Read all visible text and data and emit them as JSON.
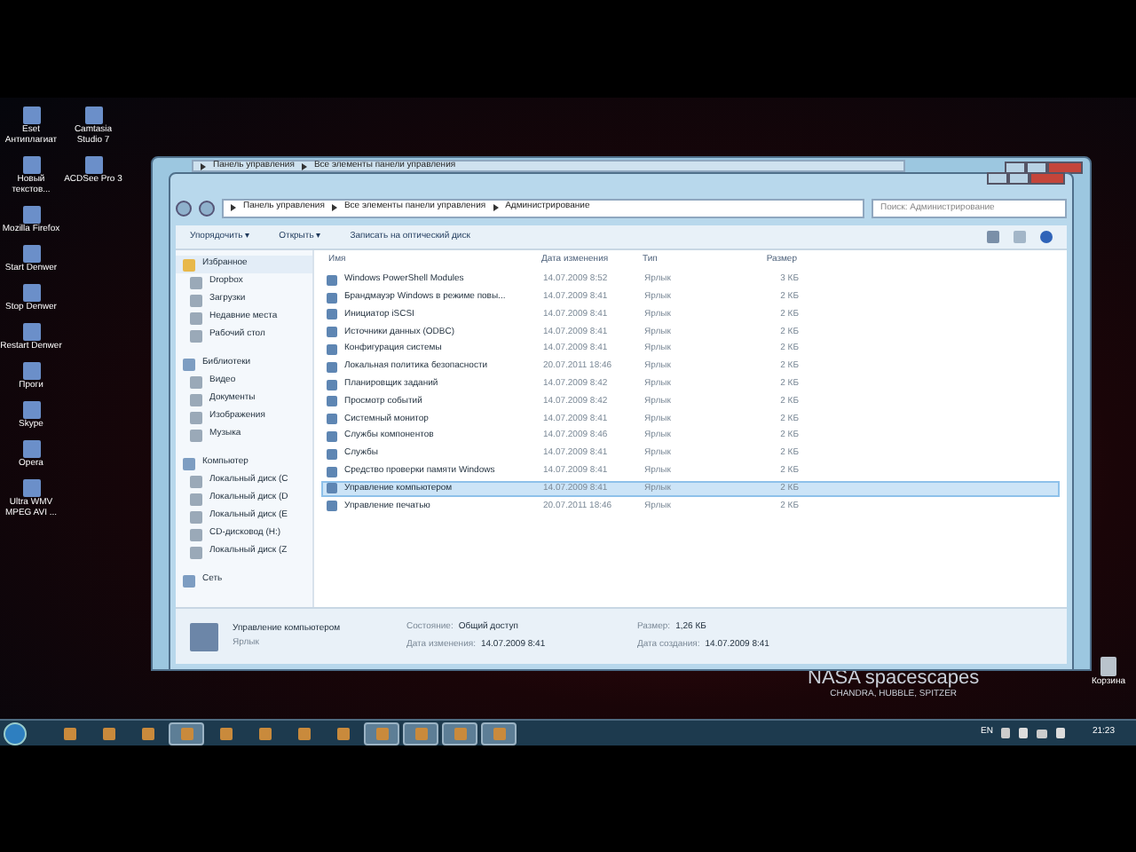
{
  "desktop_icons": [
    {
      "label": "Eset Антиплагиат"
    },
    {
      "label": "Camtasia Studio 7"
    },
    {
      "label": "Новый текстов..."
    },
    {
      "label": "ACDSee Pro 3"
    },
    {
      "label": "Mozilla Firefox"
    },
    {
      "label": "Start Denwer"
    },
    {
      "label": "Stop Denwer"
    },
    {
      "label": "Restart Denwer"
    },
    {
      "label": "Проги"
    },
    {
      "label": "Skype"
    },
    {
      "label": "Opera"
    },
    {
      "label": "Ultra WMV MPEG AVI ..."
    }
  ],
  "recycle_bin": {
    "label": "Корзина"
  },
  "wallpaper": {
    "title": "NASA spacescapes",
    "subtitle": "CHANDRA, HUBBLE, SPITZER"
  },
  "back_window": {
    "breadcrumb": [
      "Панель управления",
      "Все элементы панели управления"
    ]
  },
  "window": {
    "breadcrumb": [
      "Панель управления",
      "Все элементы панели управления",
      "Администрирование"
    ],
    "search": {
      "placeholder": "Поиск: Администрирование"
    },
    "toolbar": [
      "Упорядочить ▾",
      "Открыть ▾",
      "Записать на оптический диск"
    ],
    "sidebar": [
      {
        "label": "Избранное",
        "children": [
          {
            "label": "Dropbox"
          },
          {
            "label": "Загрузки"
          },
          {
            "label": "Недавние места"
          },
          {
            "label": "Рабочий стол"
          }
        ]
      },
      {
        "label": "Библиотеки",
        "children": [
          {
            "label": "Видео"
          },
          {
            "label": "Документы"
          },
          {
            "label": "Изображения"
          },
          {
            "label": "Музыка"
          }
        ]
      },
      {
        "label": "Компьютер",
        "children": [
          {
            "label": "Локальный диск (C"
          },
          {
            "label": "Локальный диск (D"
          },
          {
            "label": "Локальный диск (E"
          },
          {
            "label": "CD-дисковод (H:)"
          },
          {
            "label": "Локальный диск (Z"
          }
        ]
      },
      {
        "label": "Сеть"
      }
    ],
    "table": {
      "columns": [
        "Имя",
        "Дата изменения",
        "Тип",
        "Размер"
      ],
      "rows": [
        {
          "name": "Windows PowerShell Modules",
          "date": "14.07.2009 8:52",
          "type": "Ярлык",
          "size": "3 КБ",
          "selected": false
        },
        {
          "name": "Брандмауэр Windows в режиме повы...",
          "date": "14.07.2009 8:41",
          "type": "Ярлык",
          "size": "2 КБ",
          "selected": false
        },
        {
          "name": "Инициатор iSCSI",
          "date": "14.07.2009 8:41",
          "type": "Ярлык",
          "size": "2 КБ",
          "selected": false
        },
        {
          "name": "Источники данных (ODBC)",
          "date": "14.07.2009 8:41",
          "type": "Ярлык",
          "size": "2 КБ",
          "selected": false
        },
        {
          "name": "Конфигурация системы",
          "date": "14.07.2009 8:41",
          "type": "Ярлык",
          "size": "2 КБ",
          "selected": false
        },
        {
          "name": "Локальная политика безопасности",
          "date": "20.07.2011 18:46",
          "type": "Ярлык",
          "size": "2 КБ",
          "selected": false
        },
        {
          "name": "Планировщик заданий",
          "date": "14.07.2009 8:42",
          "type": "Ярлык",
          "size": "2 КБ",
          "selected": false
        },
        {
          "name": "Просмотр событий",
          "date": "14.07.2009 8:42",
          "type": "Ярлык",
          "size": "2 КБ",
          "selected": false
        },
        {
          "name": "Системный монитор",
          "date": "14.07.2009 8:41",
          "type": "Ярлык",
          "size": "2 КБ",
          "selected": false
        },
        {
          "name": "Службы компонентов",
          "date": "14.07.2009 8:46",
          "type": "Ярлык",
          "size": "2 КБ",
          "selected": false
        },
        {
          "name": "Службы",
          "date": "14.07.2009 8:41",
          "type": "Ярлык",
          "size": "2 КБ",
          "selected": false
        },
        {
          "name": "Средство проверки памяти Windows",
          "date": "14.07.2009 8:41",
          "type": "Ярлык",
          "size": "2 КБ",
          "selected": false
        },
        {
          "name": "Управление компьютером",
          "date": "14.07.2009 8:41",
          "type": "Ярлык",
          "size": "2 КБ",
          "selected": true
        },
        {
          "name": "Управление печатью",
          "date": "20.07.2011 18:46",
          "type": "Ярлык",
          "size": "2 КБ",
          "selected": false
        }
      ]
    },
    "details": {
      "name": "Управление компьютером",
      "type": "Ярлык",
      "fields": [
        {
          "label": "Состояние:",
          "value": "Общий доступ"
        },
        {
          "label": "Размер:",
          "value": "1,26 КБ"
        },
        {
          "label": "Дата изменения:",
          "value": "14.07.2009 8:41"
        },
        {
          "label": "Дата создания:",
          "value": "14.07.2009 8:41"
        }
      ]
    }
  },
  "taskbar": {
    "buttons": [
      {
        "active": false
      },
      {
        "active": false
      },
      {
        "active": false
      },
      {
        "active": true
      },
      {
        "active": false
      },
      {
        "active": false
      },
      {
        "active": false
      },
      {
        "active": false
      },
      {
        "active": true
      },
      {
        "active": true
      },
      {
        "active": true
      },
      {
        "active": true
      }
    ],
    "language": "EN",
    "clock": "21:23"
  }
}
